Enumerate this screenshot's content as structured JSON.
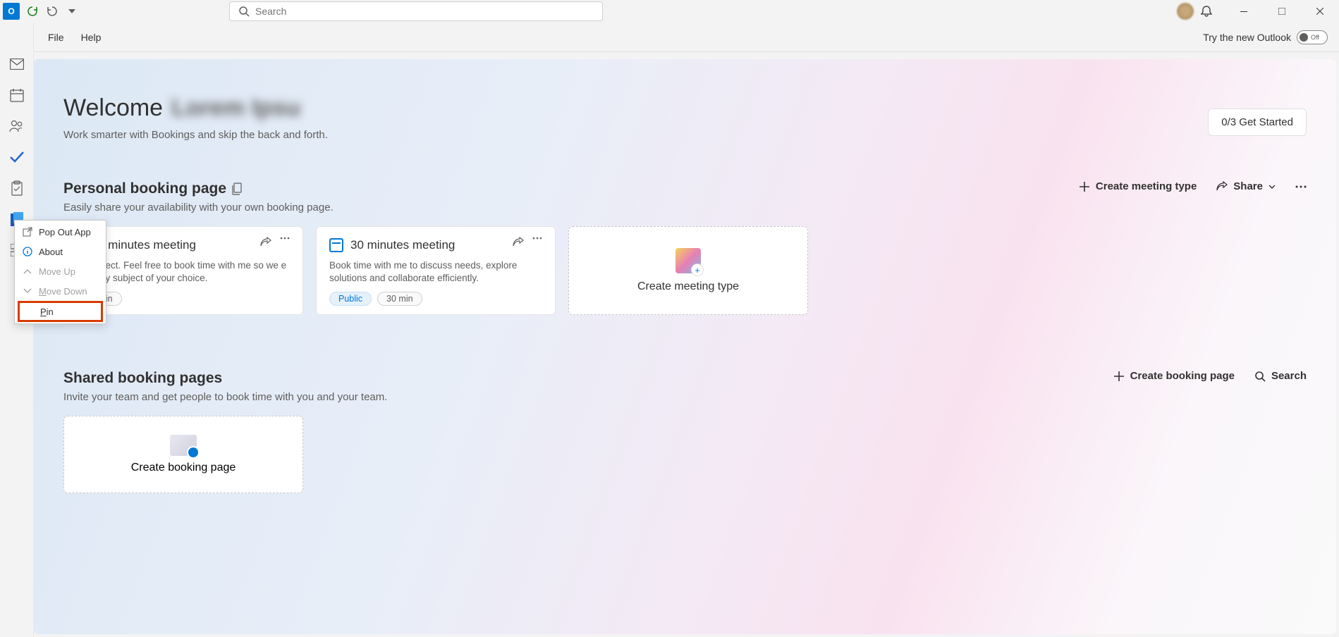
{
  "titlebar": {
    "search_placeholder": "Search"
  },
  "menubar": {
    "file": "File",
    "help": "Help",
    "try_label": "Try the new Outlook",
    "toggle_state": "Off"
  },
  "welcome": {
    "prefix": "Welcome",
    "name": "Lorem Ipsu",
    "subtitle": "Work smarter with Bookings and skip the back and forth.",
    "get_started": "0/3  Get Started"
  },
  "personal": {
    "title": "Personal booking page",
    "subtitle": "Easily share your availability with your own booking page.",
    "actions": {
      "create": "Create meeting type",
      "share": "Share"
    },
    "cards": [
      {
        "title": "5 minutes meeting",
        "desc": "o connect. Feel free to book time with me so we e into any subject of your choice.",
        "tag_duration": "15 min"
      },
      {
        "title": "30 minutes meeting",
        "desc": "Book time with me to discuss needs, explore solutions and collaborate efficiently.",
        "tag_public": "Public",
        "tag_duration": "30 min"
      }
    ],
    "create_card": "Create meeting type"
  },
  "shared": {
    "title": "Shared booking pages",
    "subtitle": "Invite your team and get people to book time with you and your team.",
    "actions": {
      "create": "Create booking page",
      "search": "Search"
    },
    "create_card": "Create booking page"
  },
  "context_menu": {
    "popout": "Pop Out App",
    "about": "About",
    "moveup": "Move Up",
    "movedown": "Move Down",
    "pin": "Pin"
  }
}
